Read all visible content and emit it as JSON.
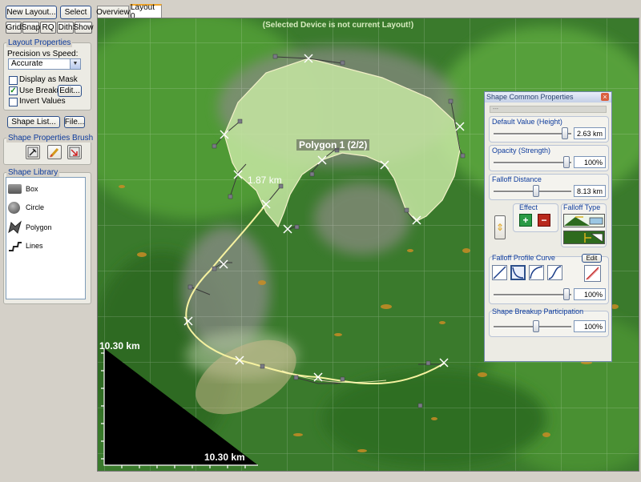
{
  "toolbar": {
    "new_layout": "New Layout...",
    "select": "Select",
    "grid": "Grid",
    "snap": "Snap",
    "rq": "RQ",
    "dith": "Dith",
    "show": "Show"
  },
  "layout_properties": {
    "title": "Layout Properties",
    "precision_label": "Precision vs Speed:",
    "precision_value": "Accurate",
    "display_as_mask": "Display as Mask",
    "use_breakup": "Use Breakup",
    "edit": "Edit...",
    "invert_values": "Invert Values",
    "display_as_mask_checked": false,
    "use_breakup_checked": true,
    "invert_values_checked": false
  },
  "shape_list_button": "Shape List...",
  "file_button": "File...",
  "brush": {
    "title": "Shape Properties Brush"
  },
  "library": {
    "title": "Shape Library",
    "items": [
      "Box",
      "Circle",
      "Polygon",
      "Lines"
    ]
  },
  "tabs": [
    "Overview",
    "Layout 0"
  ],
  "viewport": {
    "warning": "(Selected Device is not current Layout!)",
    "polygon_label": "Polygon 1 (2/2)",
    "distance_label": "1.87 km",
    "scale_vertical": "10.30 km",
    "scale_horizontal": "10.30 km"
  },
  "props": {
    "title": "Shape Common Properties",
    "close": "×",
    "name_field": "---",
    "default_value": {
      "title": "Default Value (Height)",
      "value": "2.63 km",
      "fraction": 0.95
    },
    "opacity": {
      "title": "Opacity (Strength)",
      "value": "100%",
      "fraction": 0.98
    },
    "falloff_distance": {
      "title": "Falloff Distance",
      "value": "8.13 km",
      "fraction": 0.55
    },
    "effect": {
      "title": "Effect",
      "plus": "+",
      "minus": "−"
    },
    "falloff_type": {
      "title": "Falloff Type"
    },
    "profile_curve": {
      "title": "Falloff Profile Curve",
      "edit": "Edit",
      "value": "100%",
      "fraction": 0.98
    },
    "breakup": {
      "title": "Shape Breakup Participation",
      "value": "100%",
      "fraction": 0.55
    }
  }
}
